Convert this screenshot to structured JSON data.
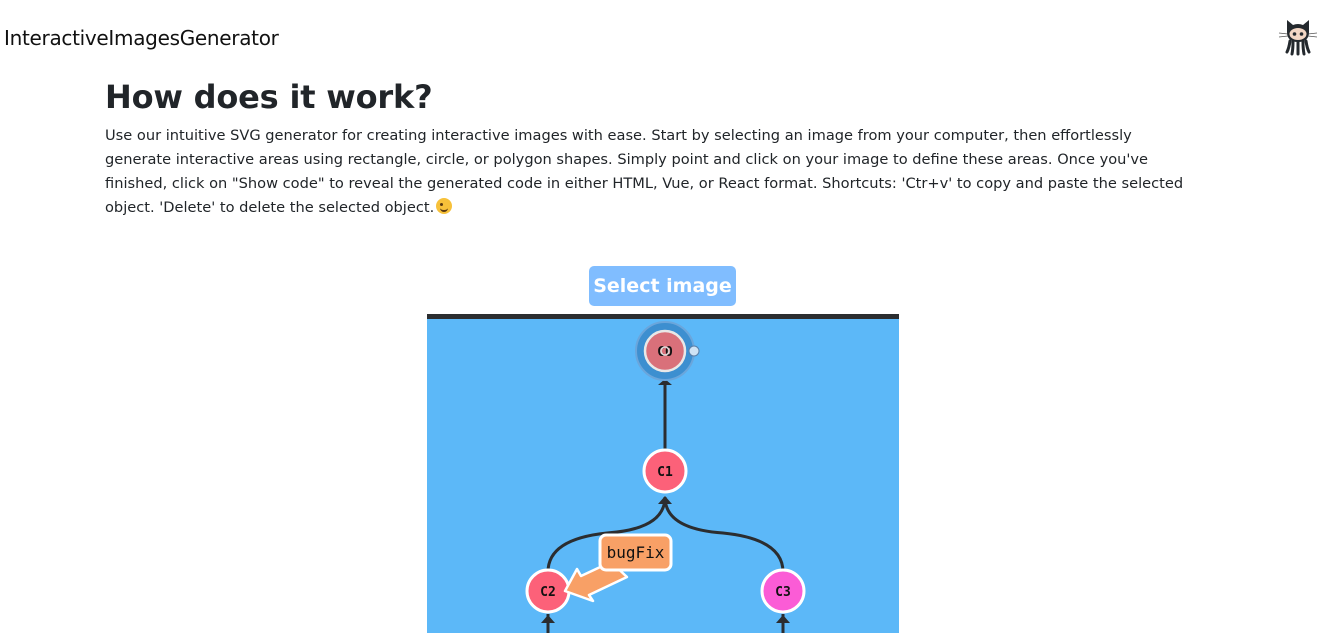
{
  "header": {
    "brand": "InteractiveImagesGenerator",
    "github_icon": "github-octocat-icon"
  },
  "main": {
    "title": "How does it work?",
    "description": "Use our intuitive SVG generator for creating interactive images with ease. Start by selecting an image from your computer, then effortlessly generate interactive areas using rectangle, circle, or polygon shapes. Simply point and click on your image to define these areas. Once you've finished, click on \"Show code\" to reveal the generated code in either HTML, Vue, or React format. Shortcuts: 'Ctr+v' to copy and paste the selected object. 'Delete' to delete the selected object.",
    "description_emoji": "winking-face-emoji",
    "select_image_label": "Select image"
  },
  "image": {
    "background": "#5cb8f8",
    "nodes": [
      {
        "label": "C0",
        "color": "#d9707a"
      },
      {
        "label": "C1",
        "color": "#fc6179"
      },
      {
        "label": "C2",
        "color": "#fc6179"
      },
      {
        "label": "C3",
        "color": "#fb5cd6"
      }
    ],
    "branch_tag": "bugFix",
    "branch_tag_color": "#f8a066"
  }
}
